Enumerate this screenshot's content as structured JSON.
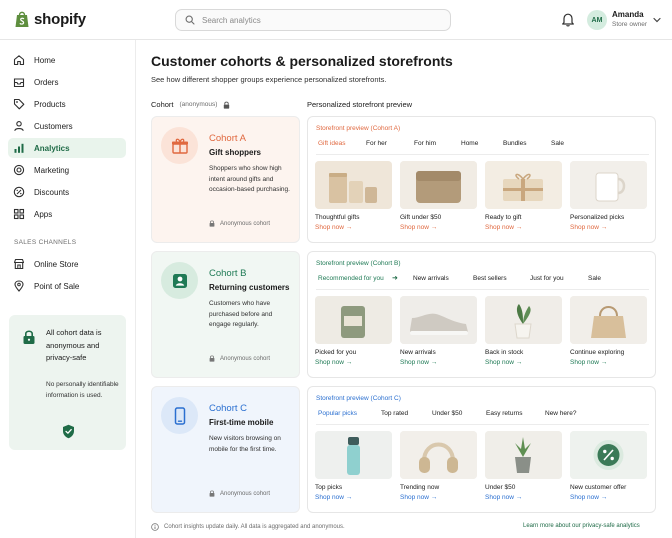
{
  "app": {
    "brand": "shopify"
  },
  "search": {
    "placeholder": "Search analytics"
  },
  "user": {
    "initials": "AM",
    "name": "Amanda",
    "role": "Store owner"
  },
  "sidebar": {
    "items": [
      {
        "label": "Home",
        "icon": "home-icon"
      },
      {
        "label": "Orders",
        "icon": "orders-icon"
      },
      {
        "label": "Products",
        "icon": "tag-icon"
      },
      {
        "label": "Customers",
        "icon": "person-icon"
      },
      {
        "label": "Analytics",
        "icon": "bar-chart-icon",
        "active": true
      },
      {
        "label": "Marketing",
        "icon": "target-icon"
      },
      {
        "label": "Discounts",
        "icon": "discount-icon"
      },
      {
        "label": "Apps",
        "icon": "apps-icon"
      }
    ],
    "section_title": "SALES CHANNELS",
    "channels": [
      {
        "label": "Online Store",
        "icon": "store-icon"
      },
      {
        "label": "Point of Sale",
        "icon": "pos-icon"
      }
    ],
    "privacy_card": {
      "title": "All cohort data is anonymous and privacy-safe",
      "body": "No personally identifiable information is used."
    }
  },
  "page": {
    "title": "Customer cohorts & personalized storefronts",
    "subtitle": "See how different shopper groups experience personalized storefronts.",
    "cohort_header": "Cohort",
    "cohort_header_note": "(anonymous)",
    "preview_header": "Personalized storefront preview"
  },
  "cohorts": [
    {
      "name": "Cohort A",
      "title": "Gift shoppers",
      "description": "Shoppers who show high intent around gifts and occasion-based purchasing.",
      "anon_label": "Anonymous cohort",
      "accent": "#e0683f",
      "tint": "#fdf4ef",
      "icon_bg": "#fbe3d8",
      "icon": "gift-icon",
      "preview": {
        "label": "Storefront preview (Cohort A)",
        "tabs": [
          "Gift ideas",
          "For her",
          "For him",
          "Home",
          "Bundles",
          "Sale"
        ],
        "products": [
          {
            "name": "Thoughtful gifts",
            "link": "Shop now →"
          },
          {
            "name": "Gift under $50",
            "link": "Shop now →"
          },
          {
            "name": "Ready to gift",
            "link": "Shop now →"
          },
          {
            "name": "Personalized picks",
            "link": "Shop now →"
          }
        ]
      }
    },
    {
      "name": "Cohort B",
      "title": "Returning customers",
      "description": "Customers who have purchased before and engage regularly.",
      "anon_label": "Anonymous cohort",
      "accent": "#1f7a55",
      "tint": "#f1f7f3",
      "icon_bg": "#d7ebdf",
      "icon": "person-badge-icon",
      "preview": {
        "label": "Storefront preview (Cohort B)",
        "tabs": [
          "Recommended for you",
          "New arrivals",
          "Best sellers",
          "Just for you",
          "Sale"
        ],
        "products": [
          {
            "name": "Picked for you",
            "link": "Shop now →"
          },
          {
            "name": "New arrivals",
            "link": "Shop now →"
          },
          {
            "name": "Back in stock",
            "link": "Shop now →"
          },
          {
            "name": "Continue exploring",
            "link": "Shop now →"
          }
        ]
      }
    },
    {
      "name": "Cohort C",
      "title": "First-time mobile",
      "description": "New visitors browsing on mobile for the first time.",
      "anon_label": "Anonymous cohort",
      "accent": "#2a6fd0",
      "tint": "#f0f5fc",
      "icon_bg": "#dce8f8",
      "icon": "phone-icon",
      "preview": {
        "label": "Storefront preview (Cohort C)",
        "tabs": [
          "Popular picks",
          "Top rated",
          "Under $50",
          "Easy returns",
          "New here?"
        ],
        "products": [
          {
            "name": "Top picks",
            "link": "Shop now →"
          },
          {
            "name": "Trending now",
            "link": "Shop now →"
          },
          {
            "name": "Under $50",
            "link": "Shop now →"
          },
          {
            "name": "New customer offer",
            "link": "Shop now →"
          }
        ]
      }
    }
  ],
  "footer": {
    "note": "Cohort insights update daily. All data is aggregated and anonymous.",
    "link": "Learn more about our privacy-safe analytics"
  },
  "colors": {
    "brand_green": "#1f6b47",
    "active_bg": "#e9f4ec"
  }
}
